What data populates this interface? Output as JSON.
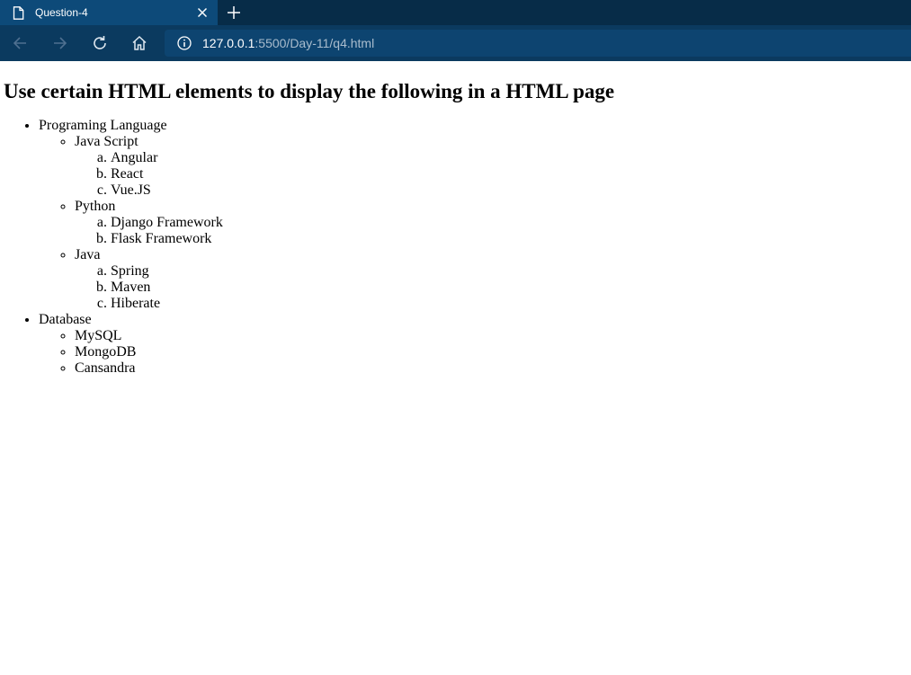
{
  "browser": {
    "tab_title": "Question-4",
    "url_host": "127.0.0.1",
    "url_path": ":5500/Day-11/q4.html"
  },
  "page": {
    "heading": "Use certain HTML elements to display the following in a HTML page",
    "sections": [
      {
        "label": "Programing Language",
        "items": [
          {
            "label": "Java Script",
            "sub": [
              "Angular",
              "React",
              "Vue.JS"
            ]
          },
          {
            "label": "Python",
            "sub": [
              "Django Framework",
              "Flask Framework"
            ]
          },
          {
            "label": "Java",
            "sub": [
              "Spring",
              "Maven",
              "Hiberate"
            ]
          }
        ]
      },
      {
        "label": "Database",
        "items": [
          {
            "label": "MySQL"
          },
          {
            "label": "MongoDB"
          },
          {
            "label": "Cansandra"
          }
        ]
      }
    ]
  }
}
